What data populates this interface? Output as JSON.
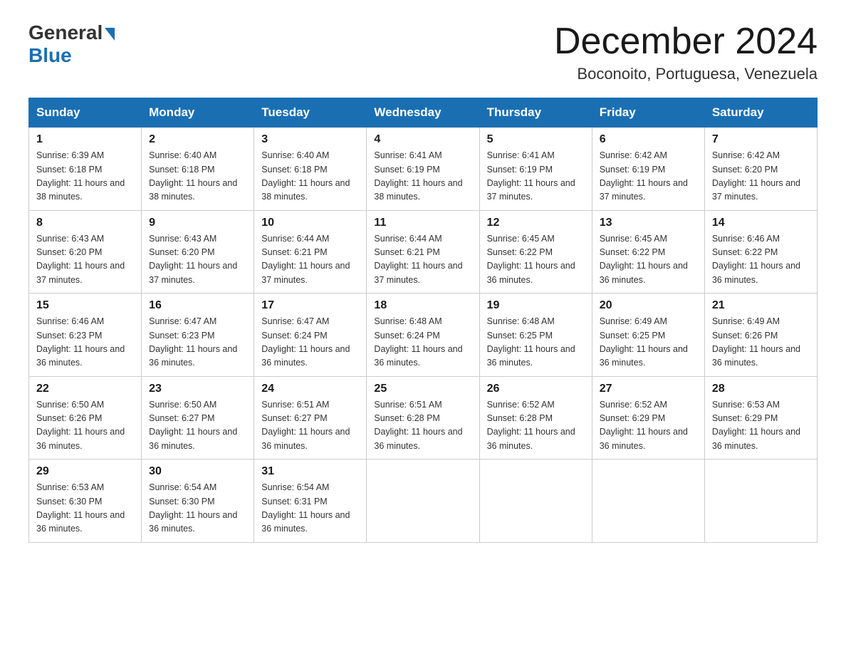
{
  "header": {
    "logo_general": "General",
    "logo_blue": "Blue",
    "month_title": "December 2024",
    "location": "Boconoito, Portuguesa, Venezuela"
  },
  "days_of_week": [
    "Sunday",
    "Monday",
    "Tuesday",
    "Wednesday",
    "Thursday",
    "Friday",
    "Saturday"
  ],
  "weeks": [
    [
      {
        "day": "1",
        "sunrise": "6:39 AM",
        "sunset": "6:18 PM",
        "daylight": "11 hours and 38 minutes."
      },
      {
        "day": "2",
        "sunrise": "6:40 AM",
        "sunset": "6:18 PM",
        "daylight": "11 hours and 38 minutes."
      },
      {
        "day": "3",
        "sunrise": "6:40 AM",
        "sunset": "6:18 PM",
        "daylight": "11 hours and 38 minutes."
      },
      {
        "day": "4",
        "sunrise": "6:41 AM",
        "sunset": "6:19 PM",
        "daylight": "11 hours and 38 minutes."
      },
      {
        "day": "5",
        "sunrise": "6:41 AM",
        "sunset": "6:19 PM",
        "daylight": "11 hours and 37 minutes."
      },
      {
        "day": "6",
        "sunrise": "6:42 AM",
        "sunset": "6:19 PM",
        "daylight": "11 hours and 37 minutes."
      },
      {
        "day": "7",
        "sunrise": "6:42 AM",
        "sunset": "6:20 PM",
        "daylight": "11 hours and 37 minutes."
      }
    ],
    [
      {
        "day": "8",
        "sunrise": "6:43 AM",
        "sunset": "6:20 PM",
        "daylight": "11 hours and 37 minutes."
      },
      {
        "day": "9",
        "sunrise": "6:43 AM",
        "sunset": "6:20 PM",
        "daylight": "11 hours and 37 minutes."
      },
      {
        "day": "10",
        "sunrise": "6:44 AM",
        "sunset": "6:21 PM",
        "daylight": "11 hours and 37 minutes."
      },
      {
        "day": "11",
        "sunrise": "6:44 AM",
        "sunset": "6:21 PM",
        "daylight": "11 hours and 37 minutes."
      },
      {
        "day": "12",
        "sunrise": "6:45 AM",
        "sunset": "6:22 PM",
        "daylight": "11 hours and 36 minutes."
      },
      {
        "day": "13",
        "sunrise": "6:45 AM",
        "sunset": "6:22 PM",
        "daylight": "11 hours and 36 minutes."
      },
      {
        "day": "14",
        "sunrise": "6:46 AM",
        "sunset": "6:22 PM",
        "daylight": "11 hours and 36 minutes."
      }
    ],
    [
      {
        "day": "15",
        "sunrise": "6:46 AM",
        "sunset": "6:23 PM",
        "daylight": "11 hours and 36 minutes."
      },
      {
        "day": "16",
        "sunrise": "6:47 AM",
        "sunset": "6:23 PM",
        "daylight": "11 hours and 36 minutes."
      },
      {
        "day": "17",
        "sunrise": "6:47 AM",
        "sunset": "6:24 PM",
        "daylight": "11 hours and 36 minutes."
      },
      {
        "day": "18",
        "sunrise": "6:48 AM",
        "sunset": "6:24 PM",
        "daylight": "11 hours and 36 minutes."
      },
      {
        "day": "19",
        "sunrise": "6:48 AM",
        "sunset": "6:25 PM",
        "daylight": "11 hours and 36 minutes."
      },
      {
        "day": "20",
        "sunrise": "6:49 AM",
        "sunset": "6:25 PM",
        "daylight": "11 hours and 36 minutes."
      },
      {
        "day": "21",
        "sunrise": "6:49 AM",
        "sunset": "6:26 PM",
        "daylight": "11 hours and 36 minutes."
      }
    ],
    [
      {
        "day": "22",
        "sunrise": "6:50 AM",
        "sunset": "6:26 PM",
        "daylight": "11 hours and 36 minutes."
      },
      {
        "day": "23",
        "sunrise": "6:50 AM",
        "sunset": "6:27 PM",
        "daylight": "11 hours and 36 minutes."
      },
      {
        "day": "24",
        "sunrise": "6:51 AM",
        "sunset": "6:27 PM",
        "daylight": "11 hours and 36 minutes."
      },
      {
        "day": "25",
        "sunrise": "6:51 AM",
        "sunset": "6:28 PM",
        "daylight": "11 hours and 36 minutes."
      },
      {
        "day": "26",
        "sunrise": "6:52 AM",
        "sunset": "6:28 PM",
        "daylight": "11 hours and 36 minutes."
      },
      {
        "day": "27",
        "sunrise": "6:52 AM",
        "sunset": "6:29 PM",
        "daylight": "11 hours and 36 minutes."
      },
      {
        "day": "28",
        "sunrise": "6:53 AM",
        "sunset": "6:29 PM",
        "daylight": "11 hours and 36 minutes."
      }
    ],
    [
      {
        "day": "29",
        "sunrise": "6:53 AM",
        "sunset": "6:30 PM",
        "daylight": "11 hours and 36 minutes."
      },
      {
        "day": "30",
        "sunrise": "6:54 AM",
        "sunset": "6:30 PM",
        "daylight": "11 hours and 36 minutes."
      },
      {
        "day": "31",
        "sunrise": "6:54 AM",
        "sunset": "6:31 PM",
        "daylight": "11 hours and 36 minutes."
      },
      null,
      null,
      null,
      null
    ]
  ]
}
